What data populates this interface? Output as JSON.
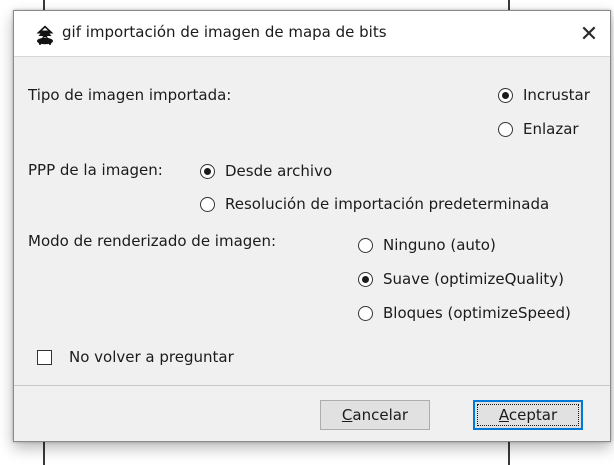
{
  "window": {
    "title": "gif importación de imagen de mapa de bits",
    "close_glyph": "✕",
    "app_icon": "inkscape-icon"
  },
  "image_type": {
    "label": "Tipo de imagen importada:",
    "options": [
      {
        "label": "Incrustar",
        "selected": true
      },
      {
        "label": "Enlazar",
        "selected": false
      }
    ]
  },
  "dpi": {
    "label": "PPP de la imagen:",
    "options": [
      {
        "label": "Desde archivo",
        "selected": true
      },
      {
        "label": "Resolución de importación predeterminada",
        "selected": false
      }
    ]
  },
  "rendering": {
    "label": "Modo de renderizado de imagen:",
    "options": [
      {
        "label": "Ninguno (auto)",
        "selected": false
      },
      {
        "label": "Suave (optimizeQuality)",
        "selected": true
      },
      {
        "label": "Bloques (optimizeSpeed)",
        "selected": false
      }
    ]
  },
  "dont_ask": {
    "label": "No volver a preguntar",
    "checked": false
  },
  "buttons": {
    "cancel": {
      "mnemonic": "C",
      "rest": "ancelar"
    },
    "accept": {
      "mnemonic": "A",
      "rest": "ceptar"
    }
  },
  "colors": {
    "dialog_bg": "#f0f0f0",
    "focus_accent": "#0078d7"
  }
}
